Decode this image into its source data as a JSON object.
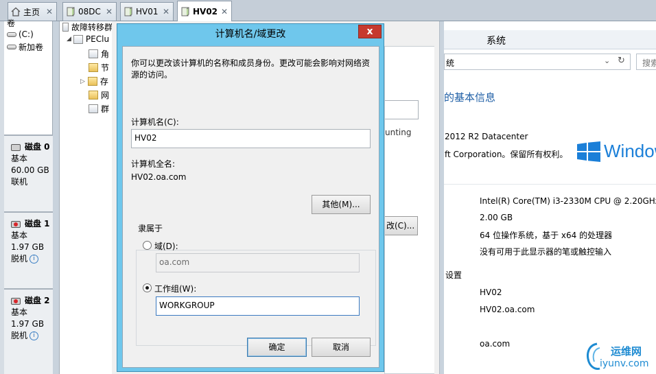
{
  "tabs": [
    {
      "label": "主页",
      "icon": "home-icon",
      "active": false
    },
    {
      "label": "08DC",
      "icon": "server-icon",
      "active": false
    },
    {
      "label": "HV01",
      "icon": "server-icon",
      "active": false
    },
    {
      "label": "HV02",
      "icon": "server-icon",
      "active": true
    }
  ],
  "tab_close_glyph": "✕",
  "left_panel": {
    "top_cut_label": "卷",
    "volumes": [
      "(C:)",
      "新加卷"
    ],
    "disks": [
      {
        "name": "磁盘 0",
        "type": "基本",
        "size": "60.00 GB",
        "status": "联机",
        "icon": "disk-icon"
      },
      {
        "name": "磁盘 1",
        "type": "基本",
        "size": "1.97 GB",
        "status": "脱机",
        "icon": "disk-offline-icon"
      },
      {
        "name": "磁盘 2",
        "type": "基本",
        "size": "1.97 GB",
        "status": "脱机",
        "icon": "disk-offline-icon"
      }
    ]
  },
  "tree": {
    "root": "故障转移群",
    "cluster": "PEClu",
    "children": [
      "角",
      "节",
      "存",
      "网",
      "群"
    ]
  },
  "behind_dialog": {
    "partial_text": "unting",
    "partial_button": "改(C)..."
  },
  "system": {
    "header": "系统",
    "address": "统",
    "search_placeholder": "搜索",
    "basic_info_heading": "的基本信息",
    "edition": "2012 R2 Datacenter",
    "copyright": "ft Corporation。保留所有权利。",
    "brand": "Window",
    "processor": "Intel(R) Core(TM) i3-2330M CPU @ 2.20GHz",
    "memory": "2.00 GB",
    "system_type": "64 位操作系统，基于 x64 的处理器",
    "pen_touch": "没有可用于此显示器的笔或触控输入",
    "settings_heading": "设置",
    "computer_name": "HV02",
    "full_name": "HV02.oa.com",
    "domain": "oa.com"
  },
  "dialog": {
    "title": "计算机名/域更改",
    "close_glyph": "x",
    "description_line1": "你可以更改该计算机的名称和成员身份。更改可能会影响对网络资",
    "description_line2": "源的访问。",
    "computer_name_label": "计算机名(C):",
    "computer_name_value": "HV02",
    "full_name_label": "计算机全名:",
    "full_name_value": "HV02.oa.com",
    "more_button": "其他(M)...",
    "member_of_label": "隶属于",
    "domain_radio_label": "域(D):",
    "domain_value": "oa.com",
    "workgroup_radio_label": "工作组(W):",
    "workgroup_value": "WORKGROUP",
    "selected": "workgroup",
    "ok_button": "确定",
    "cancel_button": "取消"
  },
  "watermark": {
    "line1": "运维网",
    "line2": "iyunv.com"
  },
  "colors": {
    "dialog_frame": "#6fc7ec",
    "close_button": "#c6392e",
    "windows_brand": "#1b7fd8",
    "watermark_blue": "#1e8bd2"
  }
}
